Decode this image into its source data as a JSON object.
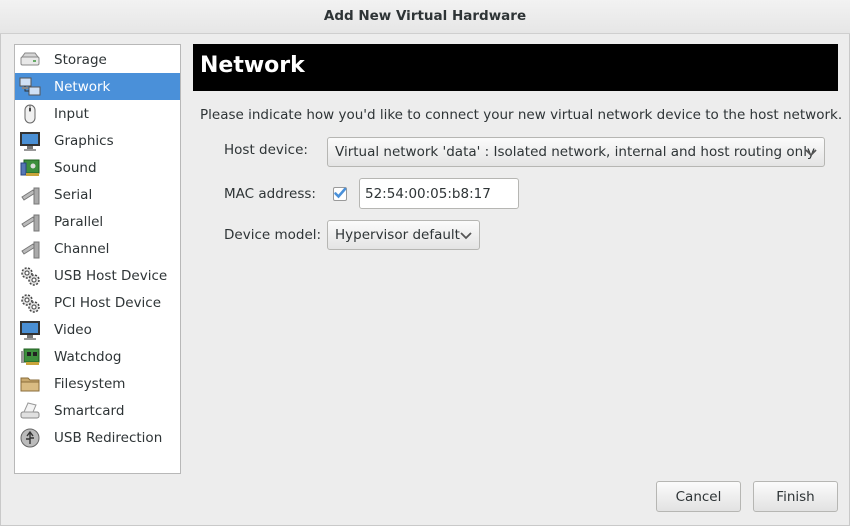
{
  "window": {
    "title": "Add New Virtual Hardware"
  },
  "sidebar": {
    "items": [
      {
        "label": "Storage",
        "icon": "storage-icon"
      },
      {
        "label": "Network",
        "icon": "network-icon",
        "selected": true
      },
      {
        "label": "Input",
        "icon": "mouse-icon"
      },
      {
        "label": "Graphics",
        "icon": "monitor-icon"
      },
      {
        "label": "Sound",
        "icon": "sound-card-icon"
      },
      {
        "label": "Serial",
        "icon": "serial-plug-icon"
      },
      {
        "label": "Parallel",
        "icon": "parallel-plug-icon"
      },
      {
        "label": "Channel",
        "icon": "channel-plug-icon"
      },
      {
        "label": "USB Host Device",
        "icon": "usb-gears-icon"
      },
      {
        "label": "PCI Host Device",
        "icon": "pci-gears-icon"
      },
      {
        "label": "Video",
        "icon": "video-monitor-icon"
      },
      {
        "label": "Watchdog",
        "icon": "watchdog-card-icon"
      },
      {
        "label": "Filesystem",
        "icon": "folder-icon"
      },
      {
        "label": "Smartcard",
        "icon": "smartcard-reader-icon"
      },
      {
        "label": "USB Redirection",
        "icon": "usb-redirection-icon"
      }
    ]
  },
  "main": {
    "title": "Network",
    "description": "Please indicate how you'd like to connect your new virtual network device to the host network.",
    "host_device": {
      "label": "Host device:",
      "value": "Virtual network 'data' : Isolated network, internal and host routing only"
    },
    "mac_address": {
      "label": "MAC address:",
      "checked": true,
      "value": "52:54:00:05:b8:17"
    },
    "device_model": {
      "label": "Device model:",
      "value": "Hypervisor default"
    }
  },
  "buttons": {
    "cancel": "Cancel",
    "finish": "Finish"
  },
  "colors": {
    "selection": "#4a90d9",
    "header_bg": "#000000",
    "check_accent": "#4a90d9"
  }
}
